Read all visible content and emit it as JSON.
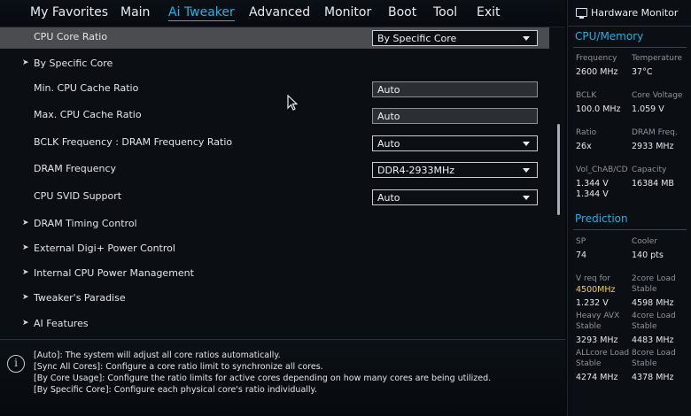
{
  "nav": {
    "tabs": [
      {
        "label": "My Favorites"
      },
      {
        "label": "Main"
      },
      {
        "label": "Ai Tweaker"
      },
      {
        "label": "Advanced"
      },
      {
        "label": "Monitor"
      },
      {
        "label": "Boot"
      },
      {
        "label": "Tool"
      },
      {
        "label": "Exit"
      }
    ],
    "active": "Ai Tweaker"
  },
  "settings": [
    {
      "label": "CPU Core Ratio",
      "value": "By Specific Core",
      "kind": "select",
      "highlighted": true
    },
    {
      "label": "By Specific Core",
      "kind": "submenu"
    },
    {
      "label": "Min. CPU Cache Ratio",
      "value": "Auto",
      "kind": "input"
    },
    {
      "label": "Max. CPU Cache Ratio",
      "value": "Auto",
      "kind": "input"
    },
    {
      "label": "BCLK Frequency : DRAM Frequency Ratio",
      "value": "Auto",
      "kind": "select"
    },
    {
      "label": "DRAM Frequency",
      "value": "DDR4-2933MHz",
      "kind": "select"
    },
    {
      "label": "CPU SVID Support",
      "value": "Auto",
      "kind": "select"
    },
    {
      "label": "DRAM Timing Control",
      "kind": "submenu"
    },
    {
      "label": "External Digi+ Power Control",
      "kind": "submenu"
    },
    {
      "label": "Internal CPU Power Management",
      "kind": "submenu"
    },
    {
      "label": "Tweaker's Paradise",
      "kind": "submenu"
    },
    {
      "label": "AI Features",
      "kind": "submenu"
    }
  ],
  "info": {
    "icon": "info-icon",
    "lines": [
      "[Auto]: The system will adjust all core ratios automatically.",
      "[Sync All Cores]: Configure a core ratio limit to synchronize all cores.",
      "[By Core Usage]: Configure the ratio limits for active cores depending on how many cores are being utilized.",
      "[By Specific Core]: Configure each physical core's ratio individually."
    ]
  },
  "monitor": {
    "title": "Hardware Monitor",
    "cpu_memory": {
      "heading": "CPU/Memory",
      "items": [
        {
          "label": "Frequency",
          "value": "2600 MHz"
        },
        {
          "label": "Temperature",
          "value": "37°C"
        },
        {
          "label": "BCLK",
          "value": "100.0 MHz"
        },
        {
          "label": "Core Voltage",
          "value": "1.059 V"
        },
        {
          "label": "Ratio",
          "value": "26x"
        },
        {
          "label": "DRAM Freq.",
          "value": "2933 MHz"
        },
        {
          "label": "Vol_ChAB/CD",
          "value": "1.344 V",
          "value2": "1.344 V"
        },
        {
          "label": "Capacity",
          "value": "16384 MB"
        }
      ]
    },
    "prediction": {
      "heading": "Prediction",
      "items": [
        {
          "label": "SP",
          "value": "74"
        },
        {
          "label": "Cooler",
          "value": "140 pts"
        },
        {
          "label": "V req for",
          "label_highlight": "4500MHz",
          "value": "1.232 V"
        },
        {
          "label": "2core Load",
          "label2": "Stable",
          "value": "4598 MHz"
        },
        {
          "label": "Heavy AVX",
          "label2": "Stable",
          "value": "3293 MHz"
        },
        {
          "label": "4core Load",
          "label2": "Stable",
          "value": "4483 MHz"
        },
        {
          "label": "ALLcore Load",
          "label2": "Stable",
          "value": "4274 MHz"
        },
        {
          "label": "8core Load",
          "label2": "Stable",
          "value": "4378 MHz"
        }
      ]
    },
    "accent_color": "#23aee0",
    "highlight_color": "#f2d33a"
  }
}
